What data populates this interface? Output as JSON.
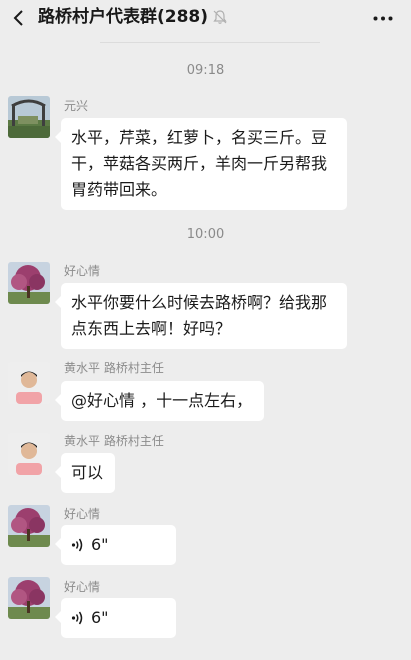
{
  "header": {
    "title": "路桥村户代表群(288)"
  },
  "icons": {
    "back": "back-chevron-icon",
    "mute": "bell-mute-icon",
    "more": "more-dots-icon",
    "voice": "voice-wave-icon"
  },
  "messages": [
    {
      "time": "09:18"
    },
    {
      "sender": "元兴",
      "text": "水平，芹菜，红萝卜，名买三斤。豆干，苹菇各买两斤，羊肉一斤另帮我胃药带回来。"
    },
    {
      "time": "10:00"
    },
    {
      "sender": "好心情",
      "text": "水平你要什么时候去路桥啊？给我那点东西上去啊！好吗？"
    },
    {
      "sender": "黄水平  路桥村主任",
      "text": "@好心情 ，十一点左右，"
    },
    {
      "sender": "黄水平  路桥村主任",
      "text": "可以"
    },
    {
      "sender": "好心情",
      "voice_duration": "6\""
    },
    {
      "sender": "好心情",
      "voice_duration": "6\""
    }
  ]
}
